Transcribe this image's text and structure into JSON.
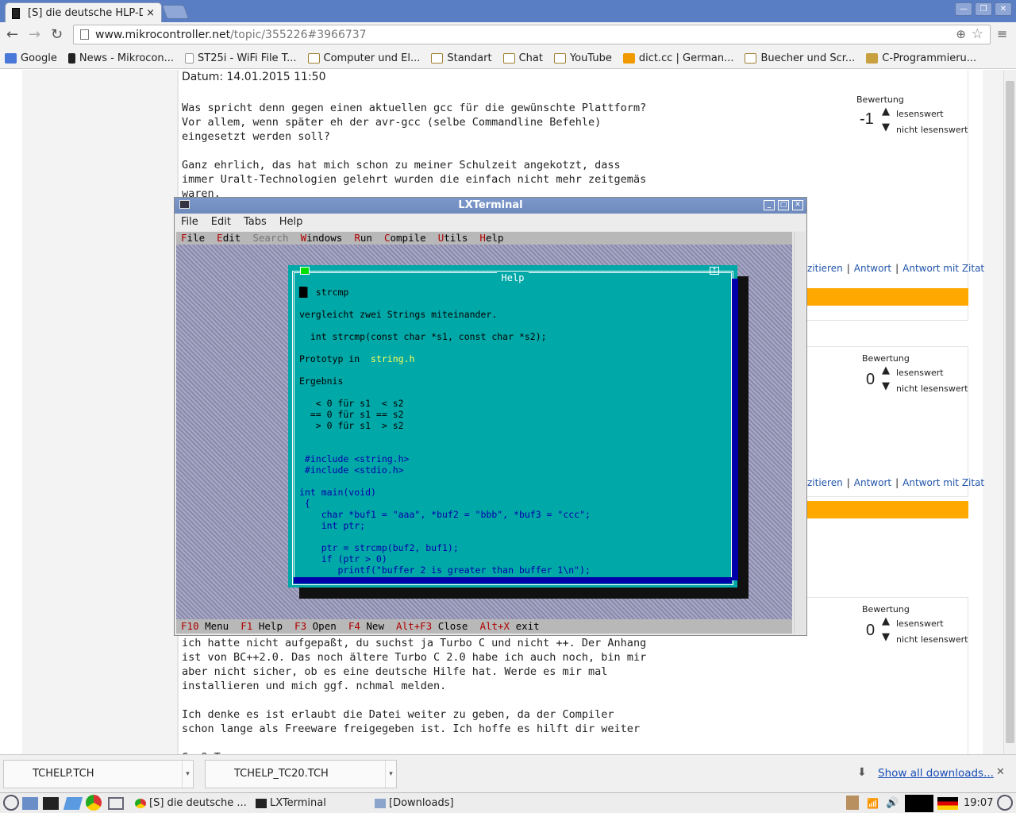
{
  "browser": {
    "tab_title": "[S] die deutsche HLP-D",
    "close_glyph": "×",
    "url_domain": "www.mikrocontroller.net",
    "url_path": "/topic/355226#3966737",
    "window_controls": [
      "—",
      "❐",
      "✕"
    ],
    "bookmarks": [
      {
        "label": "Google",
        "icon": "google-icon"
      },
      {
        "label": "News - Mikrocon...",
        "icon": "mc-icon"
      },
      {
        "label": "ST25i - WiFi File T...",
        "icon": "page-icon"
      },
      {
        "label": "Computer und El...",
        "icon": "folder-icon"
      },
      {
        "label": "Standart",
        "icon": "folder-icon"
      },
      {
        "label": "Chat",
        "icon": "folder-icon"
      },
      {
        "label": "YouTube",
        "icon": "folder-icon"
      },
      {
        "label": "dict.cc | German...",
        "icon": "dictcc-icon"
      },
      {
        "label": "Buecher und Scr...",
        "icon": "folder-icon"
      },
      {
        "label": "C-Programmieru...",
        "icon": "c-icon"
      }
    ]
  },
  "posts": {
    "p1": {
      "date": "Datum: 14.01.2015 11:50",
      "text": "Was spricht denn gegen einen aktuellen gcc für die gewünschte Plattform?\nVor allem, wenn später eh der avr-gcc (selbe Commandline Befehle)\neingesetzt werden soll?\n\nGanz ehrlich, das hat mich schon zu meiner Schulzeit angekotzt, dass\nimmer Uralt-Technologien gelehrt wurden die einfach nicht mehr zeitgemäs\nwaren.",
      "rating_label": "Bewertung",
      "score": "-1",
      "up": "lesenswert",
      "down": "nicht lesenswert"
    },
    "p2": {
      "rating_label": "Bewertung",
      "score": "0",
      "up": "lesenswert",
      "down": "nicht lesenswert"
    },
    "p3": {
      "rating_label": "Bewertung",
      "score": "0",
      "up": "lesenswert",
      "down": "nicht lesenswert",
      "text": "ich hatte nicht aufgepaßt, du suchst ja Turbo C und nicht ++. Der Anhang\nist von BC++2.0. Das noch ältere Turbo C 2.0 habe ich auch noch, bin mir\naber nicht sicher, ob es eine deutsche Hilfe hat. Werde es mir mal\ninstallieren und mich ggf. nchmal melden.\n\nIch denke es ist erlaubt die Datei weiter zu geben, da der Compiler\nschon lange als Freeware freigegeben ist. Ich hoffe es hilft dir weiter\n\nGruß Tom"
    },
    "links": {
      "quote": "zitieren",
      "answer": "Antwort",
      "answer_quote": "Antwort mit Zitat"
    }
  },
  "terminal": {
    "title": "LXTerminal",
    "menu": [
      "File",
      "Edit",
      "Tabs",
      "Help"
    ],
    "tc_menu": [
      {
        "hk": "F",
        "rest": "ile"
      },
      {
        "hk": "E",
        "rest": "dit"
      },
      {
        "hk": "",
        "rest": "Search",
        "dim": true
      },
      {
        "hk": "W",
        "rest": "indows"
      },
      {
        "hk": "R",
        "rest": "un"
      },
      {
        "hk": "C",
        "rest": "ompile"
      },
      {
        "hk": "U",
        "rest": "tils"
      },
      {
        "hk": "H",
        "rest": "elp"
      }
    ],
    "help_title": "Help",
    "help_topic": "strcmp",
    "help_desc": "vergleicht zwei Strings miteinander.",
    "help_proto": "int strcmp(const char *s1, const char *s2);",
    "help_proto_label": "Prototyp in",
    "help_header": "string.h",
    "help_result": "Ergebnis",
    "help_table": "   < 0 für s1  < s2\n  == 0 für s1 == s2\n   > 0 für s1  > s2",
    "help_code": " #include <string.h>\n #include <stdio.h>\n\nint main(void)\n {\n    char *buf1 = \"aaa\", *buf2 = \"bbb\", *buf3 = \"ccc\";\n    int ptr;\n\n    ptr = strcmp(buf2, buf1);\n    if (ptr > 0)\n       printf(\"buffer 2 is greater than buffer 1\\n\");",
    "status": [
      {
        "hk": "F10",
        "rest": "Menu"
      },
      {
        "hk": "F1",
        "rest": "Help"
      },
      {
        "hk": "F3",
        "rest": "Open"
      },
      {
        "hk": "F4",
        "rest": "New"
      },
      {
        "hk": "Alt+F3",
        "rest": "Close"
      },
      {
        "hk": "Alt+X",
        "rest": "exit"
      }
    ]
  },
  "downloads": {
    "items": [
      "TCHELP.TCH",
      "TCHELP_TC20.TCH"
    ],
    "show_all": "Show all downloads...",
    "close": "✕"
  },
  "taskbar": {
    "chrome_task": "[S] die deutsche ...",
    "term_task": "LXTerminal",
    "folder_task": "[Downloads]",
    "clock": "19:07"
  }
}
